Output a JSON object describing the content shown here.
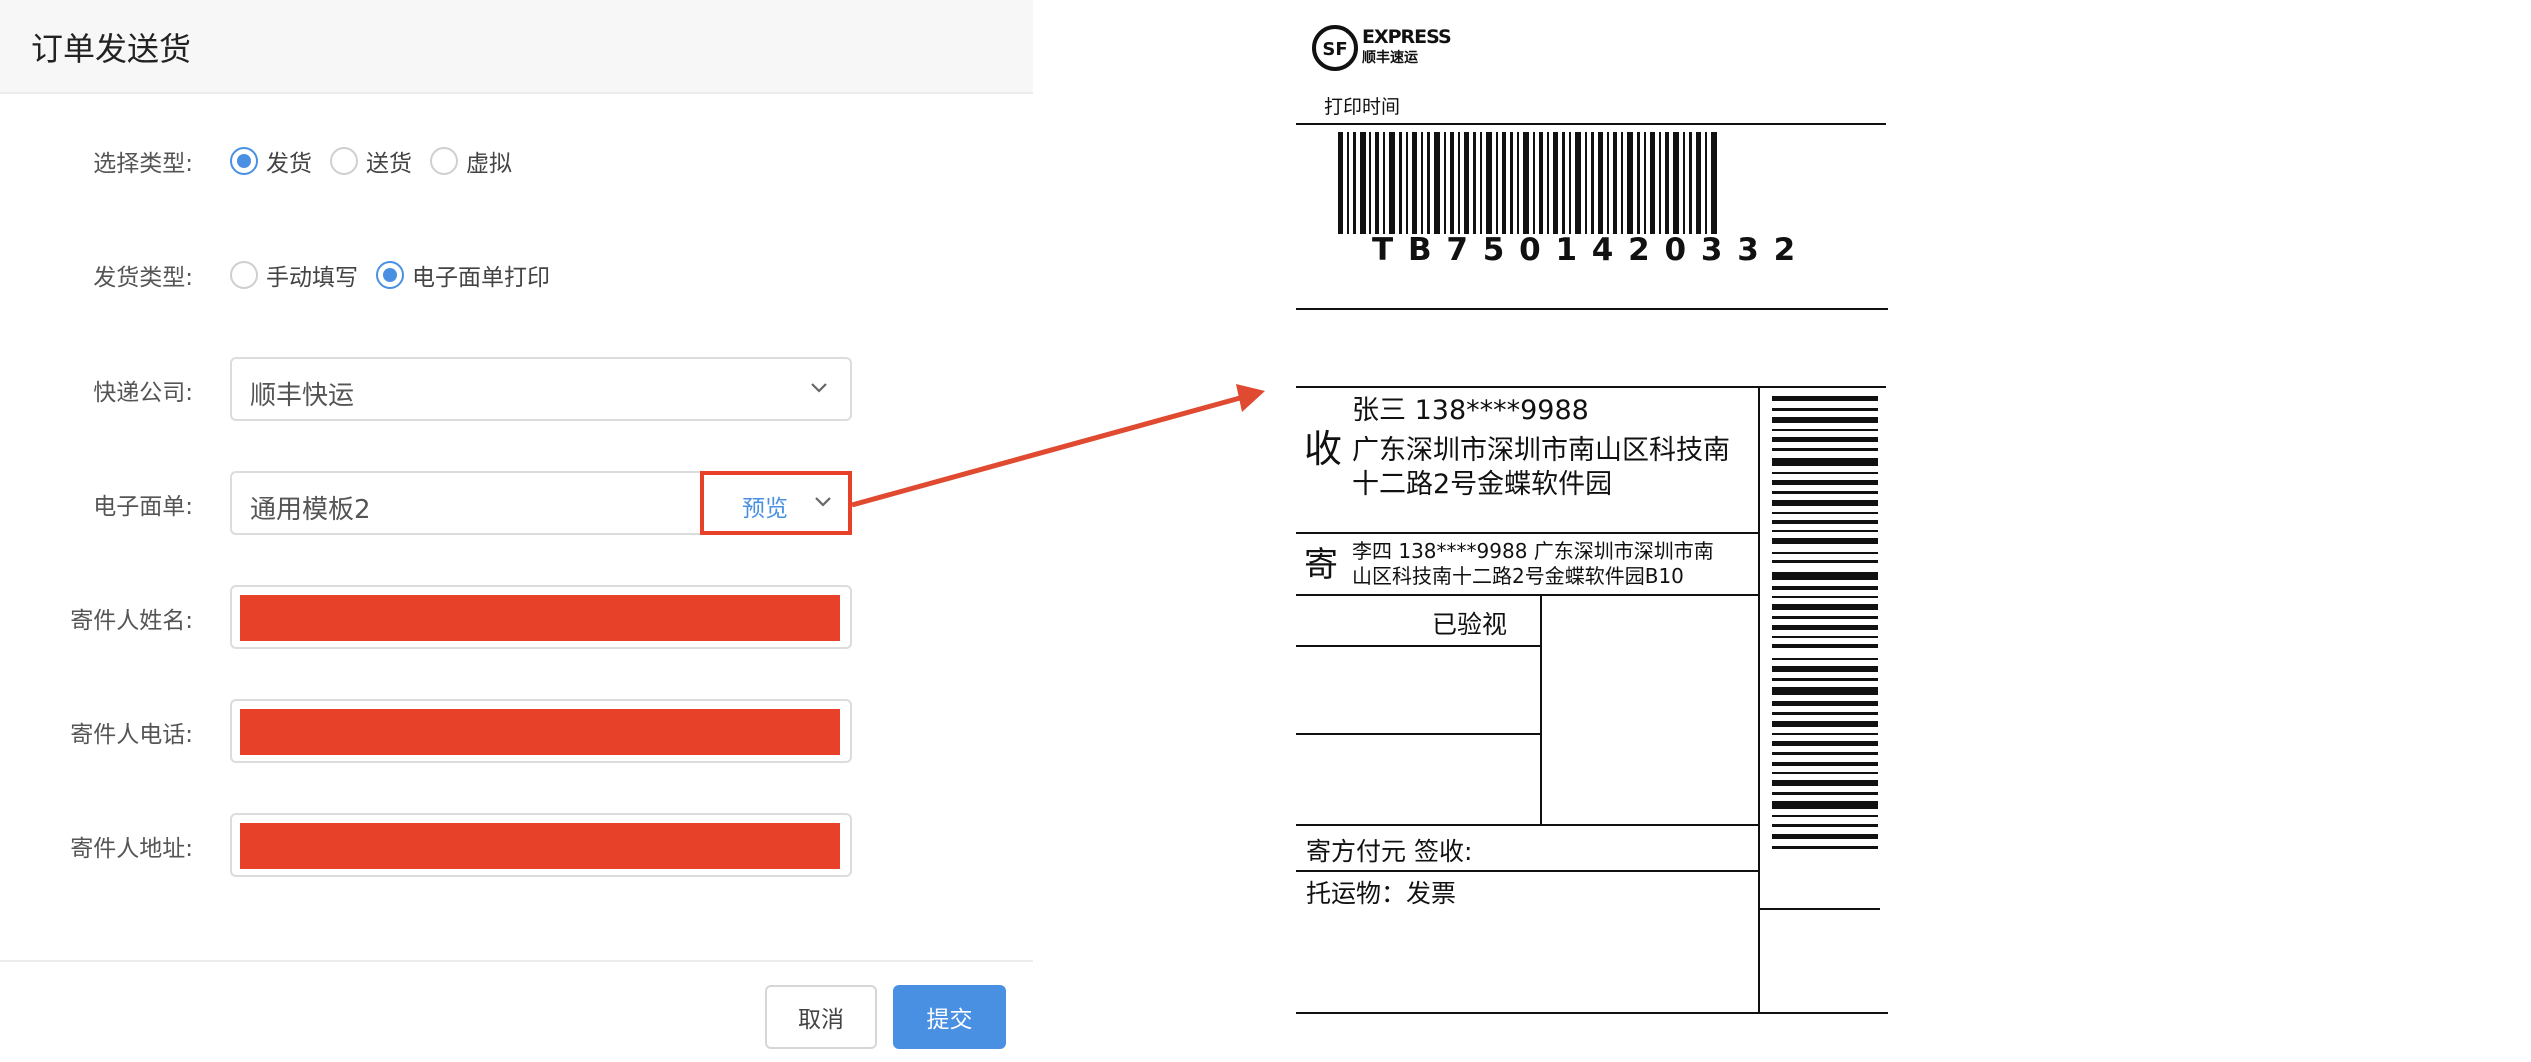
{
  "dialog": {
    "title": "订单发送货",
    "ship_type": {
      "label": "选择类型:",
      "options": [
        "发货",
        "送货",
        "虚拟"
      ],
      "selected": "发货"
    },
    "delivery_type": {
      "label": "发货类型:",
      "options": [
        "手动填写",
        "电子面单打印"
      ],
      "selected": "电子面单打印"
    },
    "courier": {
      "label": "快递公司:",
      "value": "顺丰快运"
    },
    "waybill_template": {
      "label": "电子面单:",
      "value": "通用模板2",
      "preview_link": "预览"
    },
    "sender_name": {
      "label": "寄件人姓名:"
    },
    "sender_phone": {
      "label": "寄件人电话:"
    },
    "sender_address": {
      "label": "寄件人地址:"
    },
    "buttons": {
      "cancel": "取消",
      "submit": "提交"
    }
  },
  "waybill": {
    "logo_text_1": "EXPRESS",
    "logo_text_2": "顺丰速运",
    "logo_mark": "SF",
    "print_time_label": "打印时间",
    "tracking_number": "T B 7 5 0 1 4 2 0 3 3 2",
    "recipient": {
      "tag": "收",
      "name_phone": "张三  138****9988",
      "address_line1": "广东深圳市深圳市南山区科技南",
      "address_line2": "十二路2号金蝶软件园"
    },
    "sender": {
      "tag": "寄",
      "line1": "李四 138****9988   广东深圳市深圳市南",
      "line2": "山区科技南十二路2号金蝶软件园B10"
    },
    "inspected": "已验视",
    "payment_sign": "寄方付元  签收:",
    "goods": "托运物：发票"
  },
  "colors": {
    "accent": "#4a90e2",
    "highlight": "#e8412a"
  }
}
